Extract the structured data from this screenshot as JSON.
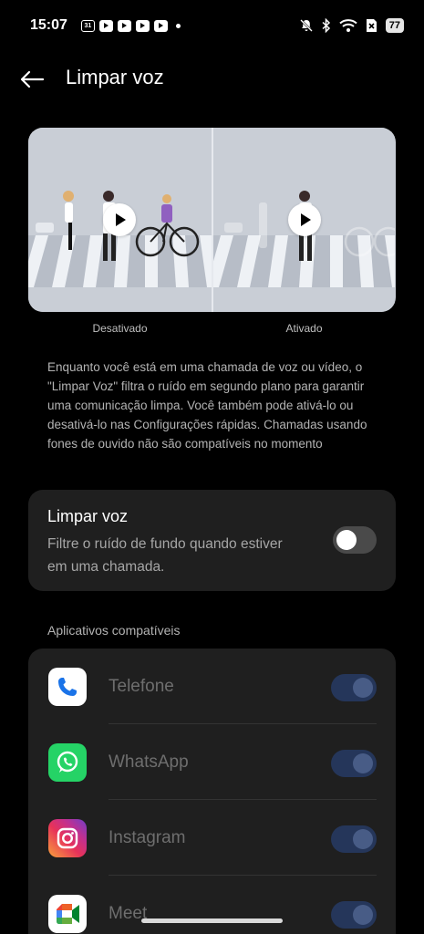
{
  "status_bar": {
    "time": "15:07",
    "calendar_day": "31",
    "notification_icons": [
      "calendar-icon",
      "youtube-icon",
      "youtube-icon",
      "youtube-icon",
      "youtube-icon"
    ],
    "right_icons": [
      "mute-icon",
      "bluetooth-icon",
      "wifi-icon",
      "no-sim-icon"
    ],
    "battery": "77"
  },
  "header": {
    "title": "Limpar voz",
    "back_icon": "arrow-left-icon"
  },
  "illustration": {
    "left_caption": "Desativado",
    "right_caption": "Ativado"
  },
  "description": "Enquanto você está em uma chamada de voz ou vídeo, o \"Limpar Voz\" filtra o ruído em segundo plano para garantir uma comunicação limpa. Você também pode ativá-lo ou desativá-lo nas Configurações rápidas. Chamadas usando fones de ouvido não são compatíveis no momento",
  "setting": {
    "title": "Limpar voz",
    "subtitle": "Filtre o ruído de fundo quando estiver em uma chamada.",
    "enabled": false
  },
  "apps_section": {
    "label": "Aplicativos compatíveis",
    "apps": [
      {
        "name": "Telefone",
        "icon": "phone-icon",
        "enabled": true
      },
      {
        "name": "WhatsApp",
        "icon": "whatsapp-icon",
        "enabled": true
      },
      {
        "name": "Instagram",
        "icon": "instagram-icon",
        "enabled": true
      },
      {
        "name": "Meet",
        "icon": "meet-icon",
        "enabled": true
      }
    ]
  },
  "colors": {
    "background": "#000000",
    "card": "#1f1f1f",
    "toggle_on_track": "#25365a",
    "toggle_off_track": "#4a4a4a"
  }
}
